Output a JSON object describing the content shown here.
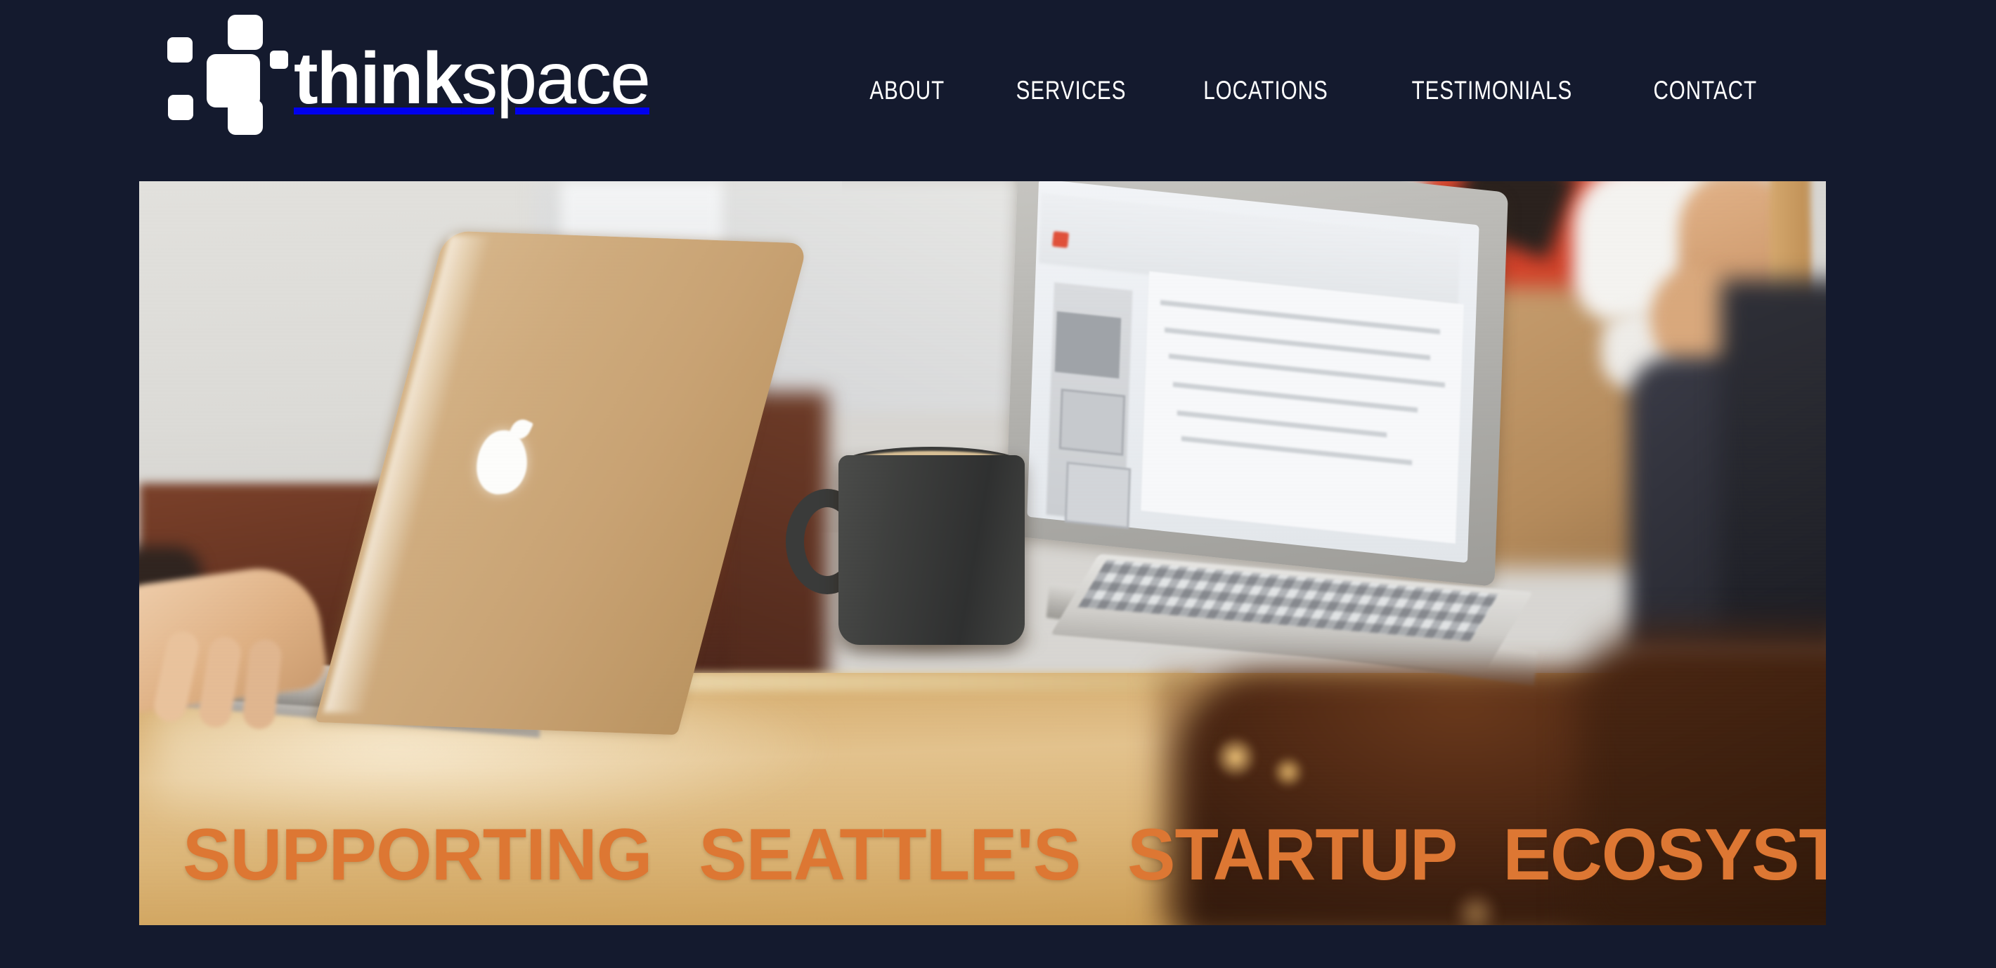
{
  "brand": {
    "logo_icon": "thinkspace-squares-logo",
    "name_bold": "think",
    "name_light": "space",
    "full_name": "thinkspace"
  },
  "nav": {
    "items": [
      {
        "label": "ABOUT"
      },
      {
        "label": "SERVICES"
      },
      {
        "label": "LOCATIONS"
      },
      {
        "label": "TESTIMONIALS"
      },
      {
        "label": "CONTACT"
      }
    ]
  },
  "hero": {
    "headline": "SUPPORTING  SEATTLE'S  STARTUP  ECOSYSTEM",
    "image_alt": "People working on laptops at a wooden cafe table with a dark coffee mug"
  },
  "colors": {
    "background_navy": "#141a2e",
    "accent_orange": "#dd7733",
    "nav_text": "#ffffff",
    "logo_white": "#ffffff"
  }
}
